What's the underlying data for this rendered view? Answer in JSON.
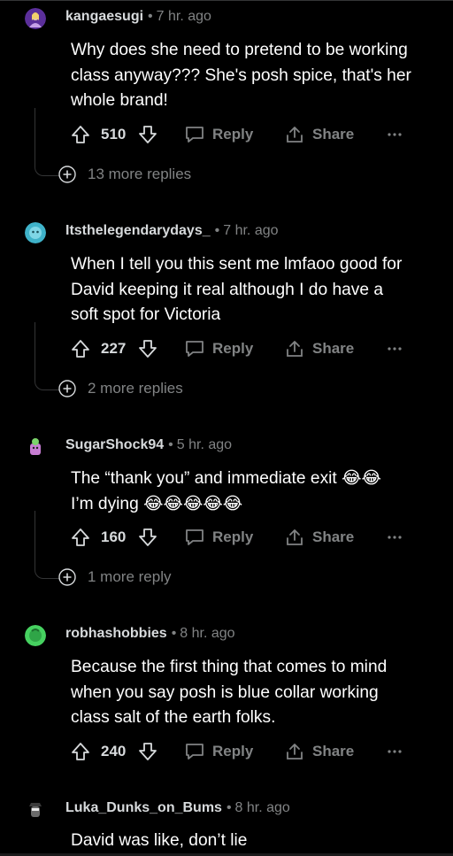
{
  "comments": [
    {
      "username": "kangaesugi",
      "age": "7 hr. ago",
      "body_lines": [
        "Why does she need to pretend to be working",
        "class anyway??? She's posh spice, that's her",
        "whole brand!"
      ],
      "score": "510",
      "reply_label": "Reply",
      "share_label": "Share",
      "more_replies": "13 more replies",
      "avatar_color": "#5b2f9a"
    },
    {
      "username": "Itsthelegendarydays_",
      "age": "7 hr. ago",
      "body_lines": [
        "When I tell you this sent me lmfaoo good for",
        "David keeping it real although I do have a",
        "soft spot for Victoria"
      ],
      "score": "227",
      "reply_label": "Reply",
      "share_label": "Share",
      "more_replies": "2 more replies",
      "avatar_color": "#3fb2c9"
    },
    {
      "username": "SugarShock94",
      "age": "5 hr. ago",
      "body_lines": [
        "The “thank you” and immediate exit 😂😂",
        "I’m dying 😂😂😂😂😂"
      ],
      "score": "160",
      "reply_label": "Reply",
      "share_label": "Share",
      "more_replies": "1 more reply",
      "avatar_color": "#c77dd3"
    },
    {
      "username": "robhashobbies",
      "age": "8 hr. ago",
      "body_lines": [
        "Because the first thing that comes to mind",
        "when you say posh is blue collar working",
        "class salt of the earth folks."
      ],
      "score": "240",
      "reply_label": "Reply",
      "share_label": "Share",
      "avatar_color": "#46d160"
    },
    {
      "username": "Luka_Dunks_on_Bums",
      "age": "8 hr. ago",
      "body_lines": [
        "David was like, don’t lie"
      ],
      "avatar_color": "#4a4a4a"
    }
  ],
  "icons": {
    "upvote": "upvote-icon",
    "downvote": "downvote-icon",
    "reply": "reply-icon",
    "share": "share-icon",
    "more": "more-options-icon",
    "expand": "expand-plus-icon"
  },
  "colors": {
    "background": "#000000",
    "text": "#ffffff",
    "muted": "#818384",
    "thread_line": "#343536"
  }
}
